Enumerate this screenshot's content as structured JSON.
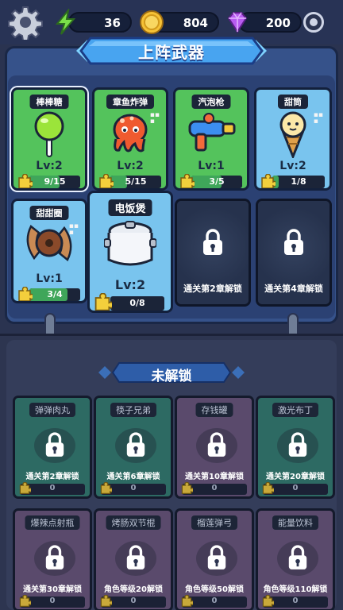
{
  "resources": {
    "energy": "36",
    "coins": "804",
    "gems": "200"
  },
  "equipped_title": "上阵武器",
  "equipped": [
    {
      "name": "棒棒糖",
      "level": "Lv:2",
      "progress": "9/15",
      "fill": 0.6,
      "style": "green",
      "icon": "lollipop-icon"
    },
    {
      "name": "章鱼炸弹",
      "level": "Lv:2",
      "progress": "5/15",
      "fill": 0.33,
      "style": "green",
      "icon": "octopus-bomb-icon"
    },
    {
      "name": "汽泡枪",
      "level": "Lv:1",
      "progress": "3/5",
      "fill": 0.6,
      "style": "green",
      "icon": "bubble-gun-icon"
    },
    {
      "name": "甜筒",
      "level": "Lv:2",
      "progress": "1/8",
      "fill": 0.125,
      "style": "blue",
      "icon": "ice-cream-icon"
    },
    {
      "name": "甜甜圈",
      "level": "Lv:1",
      "progress": "3/4",
      "fill": 0.75,
      "style": "blue",
      "icon": "donut-icon"
    },
    {
      "name": "电饭煲",
      "level": "Lv:2",
      "progress": "0/8",
      "fill": 0.0,
      "style": "blue",
      "icon": "rice-cooker-icon"
    }
  ],
  "locked_slots": [
    {
      "text": "通关第2章解锁"
    },
    {
      "text": "通关第4章解锁"
    }
  ],
  "unlocked_title": "未解锁",
  "locked_weapons": [
    {
      "name": "弹弹肉丸",
      "requirement": "通关第2章解锁",
      "count": "0",
      "style": "teal",
      "icon": "meatball-icon"
    },
    {
      "name": "筷子兄弟",
      "requirement": "通关第6章解锁",
      "count": "0",
      "style": "teal",
      "icon": "chopsticks-icon"
    },
    {
      "name": "存钱罐",
      "requirement": "通关第10章解锁",
      "count": "0",
      "style": "purple",
      "icon": "piggy-bank-icon"
    },
    {
      "name": "激光布丁",
      "requirement": "通关第20章解锁",
      "count": "0",
      "style": "teal",
      "icon": "laser-pudding-icon"
    },
    {
      "name": "爆辣点射瓶",
      "requirement": "通关第30章解锁",
      "count": "0",
      "style": "purple",
      "icon": "spray-bottle-icon"
    },
    {
      "name": "烤肠双节棍",
      "requirement": "角色等级20解锁",
      "count": "0",
      "style": "purple",
      "icon": "sausage-nunchaku-icon"
    },
    {
      "name": "榴莲弹弓",
      "requirement": "角色等级50解锁",
      "count": "0",
      "style": "purple",
      "icon": "durian-slingshot-icon"
    },
    {
      "name": "能量饮料",
      "requirement": "角色等级110解锁",
      "count": "0",
      "style": "purple",
      "icon": "energy-drink-icon"
    }
  ],
  "colors": {
    "green_card": "#54c35c",
    "blue_card": "#79c4ee",
    "panel": "#36528a",
    "bg": "#2a3350"
  }
}
